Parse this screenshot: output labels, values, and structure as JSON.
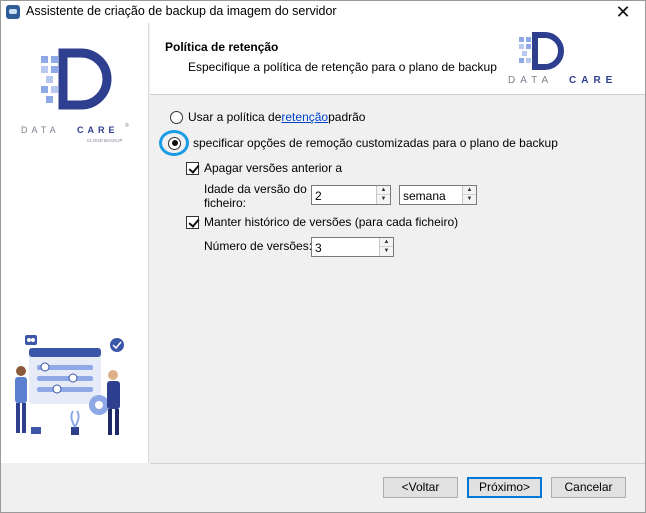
{
  "window": {
    "title": "Assistente de criação de backup da imagem do servidor",
    "close_glyph": "✕"
  },
  "brand": {
    "word_part1": "DATA",
    "word_part2": "CARE",
    "tagline": "CLOUD BACKUP",
    "registered": "®",
    "colors": {
      "primary": "#2f3f8f",
      "accent": "#8fa8e8",
      "gray": "#7b8190"
    }
  },
  "header": {
    "title": "Política de retenção",
    "subtitle": "Especifique a política de retenção para o plano de backup"
  },
  "options": {
    "default_prefix": "Usar a política de ",
    "default_link": "retenção",
    "default_suffix": " padrão",
    "custom_label": "specificar opções de remoção customizadas para o plano de backup",
    "selected": "custom"
  },
  "delete_versions": {
    "label": "Apagar versões anterior a",
    "checked": true,
    "age_label_line1": "Idade da versão do",
    "age_label_line2": "ficheiro:",
    "age_value": "2",
    "unit_value": "semana"
  },
  "keep_history": {
    "label": "Manter histórico de versões (para cada ficheiro)",
    "checked": true,
    "count_label": "Número de versões:",
    "count_value": "3"
  },
  "footer": {
    "back_label": "<Voltar",
    "next_label": "Próximo>",
    "cancel_label": "Cancelar"
  }
}
